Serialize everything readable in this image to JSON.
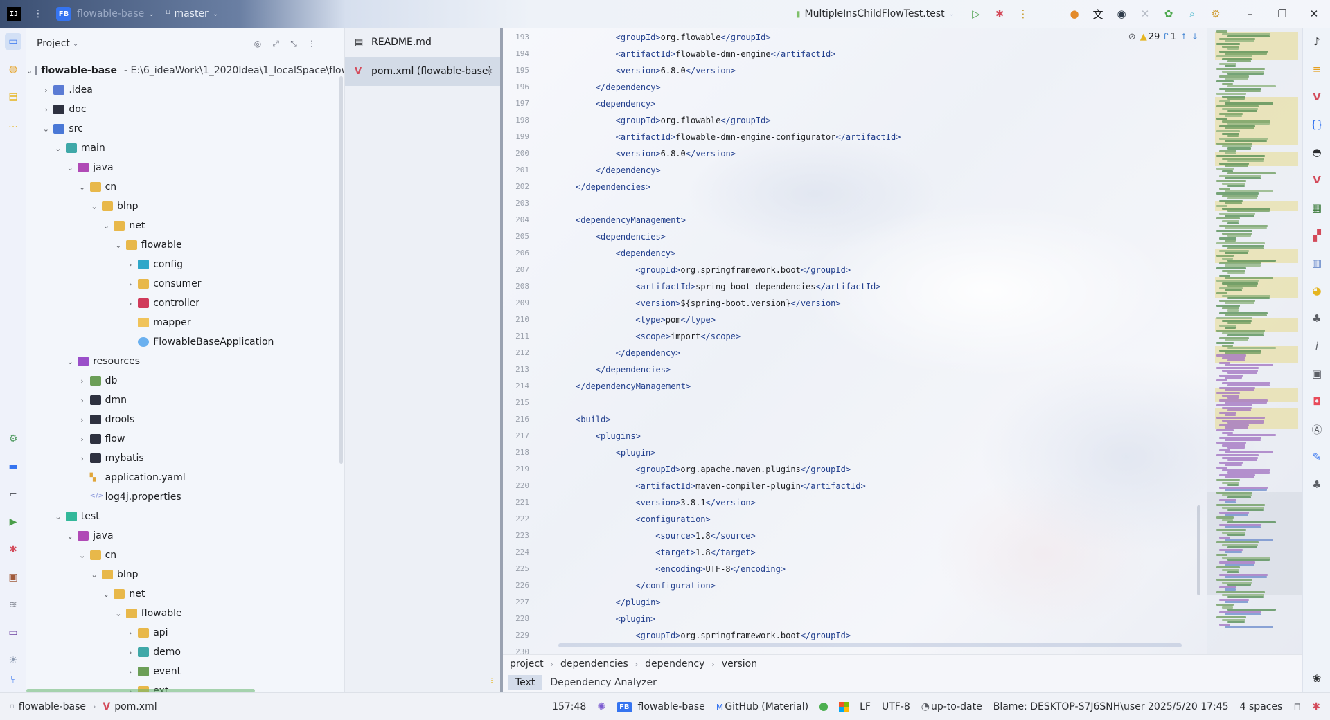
{
  "titlebar": {
    "app_logo": "IJ",
    "menu_glyph": "⋮",
    "project_badge": "FB",
    "project_name": "flowable-base",
    "branch": "master",
    "run_config": "MultipleInsChildFlowTest.test",
    "icons": [
      "run-icon",
      "debug-icon",
      "more-icon",
      "code-with-me-icon",
      "translate-icon",
      "record-icon",
      "tools-icon",
      "ai-assistant-icon",
      "search-icon",
      "settings-icon"
    ],
    "window_controls": [
      "minimize",
      "restore",
      "close"
    ]
  },
  "project_panel": {
    "title": "Project",
    "tree": [
      {
        "depth": 0,
        "arrow": "v",
        "icon": "module",
        "label": "flowable-base",
        "bold": true,
        "path": "E:\\6_ideaWork\\1_2020Idea\\1_localSpace\\flow"
      },
      {
        "depth": 1,
        "arrow": ">",
        "icon": "folder-blue",
        "label": ".idea"
      },
      {
        "depth": 1,
        "arrow": ">",
        "icon": "folder-dark",
        "label": "doc"
      },
      {
        "depth": 1,
        "arrow": "v",
        "icon": "folder-src",
        "label": "src"
      },
      {
        "depth": 2,
        "arrow": "v",
        "icon": "folder-main",
        "label": "main"
      },
      {
        "depth": 3,
        "arrow": "v",
        "icon": "folder-java",
        "label": "java"
      },
      {
        "depth": 4,
        "arrow": "v",
        "icon": "folder",
        "label": "cn"
      },
      {
        "depth": 5,
        "arrow": "v",
        "icon": "folder",
        "label": "blnp"
      },
      {
        "depth": 6,
        "arrow": "v",
        "icon": "folder",
        "label": "net"
      },
      {
        "depth": 7,
        "arrow": "v",
        "icon": "folder",
        "label": "flowable"
      },
      {
        "depth": 8,
        "arrow": ">",
        "icon": "folder-cfg",
        "label": "config"
      },
      {
        "depth": 8,
        "arrow": ">",
        "icon": "folder",
        "label": "consumer"
      },
      {
        "depth": 8,
        "arrow": ">",
        "icon": "folder-ctl",
        "label": "controller"
      },
      {
        "depth": 8,
        "arrow": "",
        "icon": "folder-plain",
        "label": "mapper"
      },
      {
        "depth": 8,
        "arrow": "",
        "icon": "spring",
        "label": "FlowableBaseApplication"
      },
      {
        "depth": 3,
        "arrow": "v",
        "icon": "folder-res",
        "label": "resources"
      },
      {
        "depth": 4,
        "arrow": ">",
        "icon": "folder-db",
        "label": "db"
      },
      {
        "depth": 4,
        "arrow": ">",
        "icon": "folder-dark",
        "label": "dmn"
      },
      {
        "depth": 4,
        "arrow": ">",
        "icon": "folder-dark",
        "label": "drools"
      },
      {
        "depth": 4,
        "arrow": ">",
        "icon": "folder-dark",
        "label": "flow"
      },
      {
        "depth": 4,
        "arrow": ">",
        "icon": "folder-dark",
        "label": "mybatis"
      },
      {
        "depth": 4,
        "arrow": "",
        "icon": "yaml",
        "label": "application.yaml"
      },
      {
        "depth": 4,
        "arrow": "",
        "icon": "props",
        "label": "log4j.properties"
      },
      {
        "depth": 2,
        "arrow": "v",
        "icon": "folder-test",
        "label": "test"
      },
      {
        "depth": 3,
        "arrow": "v",
        "icon": "folder-java",
        "label": "java"
      },
      {
        "depth": 4,
        "arrow": "v",
        "icon": "folder",
        "label": "cn"
      },
      {
        "depth": 5,
        "arrow": "v",
        "icon": "folder",
        "label": "blnp"
      },
      {
        "depth": 6,
        "arrow": "v",
        "icon": "folder",
        "label": "net"
      },
      {
        "depth": 7,
        "arrow": "v",
        "icon": "folder",
        "label": "flowable"
      },
      {
        "depth": 8,
        "arrow": ">",
        "icon": "folder",
        "label": "api"
      },
      {
        "depth": 8,
        "arrow": ">",
        "icon": "folder-main",
        "label": "demo"
      },
      {
        "depth": 8,
        "arrow": ">",
        "icon": "folder-db",
        "label": "event"
      },
      {
        "depth": 8,
        "arrow": ">",
        "icon": "folder",
        "label": "ext"
      }
    ]
  },
  "tabs": [
    {
      "label": "README.md",
      "icon": "markdown-icon",
      "active": false
    },
    {
      "label": "pom.xml (flowable-base)",
      "icon": "maven-icon",
      "active": true
    }
  ],
  "editor": {
    "inspections": {
      "warnings": "29",
      "typos": "1"
    },
    "lines": [
      {
        "n": "193",
        "indent": 2,
        "tokens": [
          [
            "t",
            "<groupId>"
          ],
          [
            "b",
            "org.flowable"
          ],
          [
            "t",
            "</groupId>"
          ]
        ]
      },
      {
        "n": "194",
        "indent": 2,
        "tokens": [
          [
            "t",
            "<artifactId>"
          ],
          [
            "b",
            "flowable-dmn-engine"
          ],
          [
            "t",
            "</artifactId>"
          ]
        ]
      },
      {
        "n": "195",
        "indent": 2,
        "tokens": [
          [
            "t",
            "<version>"
          ],
          [
            "b",
            "6.8.0"
          ],
          [
            "t",
            "</version>"
          ]
        ]
      },
      {
        "n": "196",
        "indent": 1,
        "tokens": [
          [
            "t",
            "</dependency>"
          ]
        ]
      },
      {
        "n": "197",
        "indent": 1,
        "tokens": [
          [
            "t",
            "<dependency>"
          ]
        ]
      },
      {
        "n": "198",
        "indent": 2,
        "tokens": [
          [
            "t",
            "<groupId>"
          ],
          [
            "b",
            "org.flowable"
          ],
          [
            "t",
            "</groupId>"
          ]
        ]
      },
      {
        "n": "199",
        "indent": 2,
        "tokens": [
          [
            "t",
            "<artifactId>"
          ],
          [
            "b",
            "flowable-dmn-engine-configurator"
          ],
          [
            "t",
            "</artifactId>"
          ]
        ]
      },
      {
        "n": "200",
        "indent": 2,
        "tokens": [
          [
            "t",
            "<version>"
          ],
          [
            "b",
            "6.8.0"
          ],
          [
            "t",
            "</version>"
          ]
        ]
      },
      {
        "n": "201",
        "indent": 1,
        "tokens": [
          [
            "t",
            "</dependency>"
          ]
        ]
      },
      {
        "n": "202",
        "indent": 0,
        "tokens": [
          [
            "t",
            "</dependencies>"
          ]
        ]
      },
      {
        "n": "203",
        "indent": 0,
        "tokens": []
      },
      {
        "n": "204",
        "indent": 0,
        "tokens": [
          [
            "t",
            "<dependencyManagement>"
          ]
        ]
      },
      {
        "n": "205",
        "indent": 1,
        "tokens": [
          [
            "t",
            "<dependencies>"
          ]
        ]
      },
      {
        "n": "206",
        "indent": 2,
        "tokens": [
          [
            "t",
            "<dependency>"
          ]
        ]
      },
      {
        "n": "207",
        "indent": 3,
        "tokens": [
          [
            "t",
            "<groupId>"
          ],
          [
            "b",
            "org.springframework.boot"
          ],
          [
            "t",
            "</groupId>"
          ]
        ]
      },
      {
        "n": "208",
        "indent": 3,
        "tokens": [
          [
            "t",
            "<artifactId>"
          ],
          [
            "b",
            "spring-boot-dependencies"
          ],
          [
            "t",
            "</artifactId>"
          ]
        ]
      },
      {
        "n": "209",
        "indent": 3,
        "tokens": [
          [
            "t",
            "<version>"
          ],
          [
            "b",
            "${spring-boot.version}"
          ],
          [
            "t",
            "</version>"
          ]
        ]
      },
      {
        "n": "210",
        "indent": 3,
        "tokens": [
          [
            "t",
            "<type>"
          ],
          [
            "b",
            "pom"
          ],
          [
            "t",
            "</type>"
          ]
        ]
      },
      {
        "n": "211",
        "indent": 3,
        "tokens": [
          [
            "t",
            "<scope>"
          ],
          [
            "b",
            "import"
          ],
          [
            "t",
            "</scope>"
          ]
        ]
      },
      {
        "n": "212",
        "indent": 2,
        "tokens": [
          [
            "t",
            "</dependency>"
          ]
        ]
      },
      {
        "n": "213",
        "indent": 1,
        "tokens": [
          [
            "t",
            "</dependencies>"
          ]
        ]
      },
      {
        "n": "214",
        "indent": 0,
        "tokens": [
          [
            "t",
            "</dependencyManagement>"
          ]
        ]
      },
      {
        "n": "215",
        "indent": 0,
        "tokens": []
      },
      {
        "n": "216",
        "indent": 0,
        "tokens": [
          [
            "t",
            "<build>"
          ]
        ]
      },
      {
        "n": "217",
        "indent": 1,
        "tokens": [
          [
            "t",
            "<plugins>"
          ]
        ]
      },
      {
        "n": "218",
        "indent": 2,
        "tokens": [
          [
            "t",
            "<plugin>"
          ]
        ]
      },
      {
        "n": "219",
        "indent": 3,
        "tokens": [
          [
            "t",
            "<groupId>"
          ],
          [
            "b",
            "org.apache.maven.plugins"
          ],
          [
            "t",
            "</groupId>"
          ]
        ]
      },
      {
        "n": "220",
        "indent": 3,
        "tokens": [
          [
            "t",
            "<artifactId>"
          ],
          [
            "b",
            "maven-compiler-plugin"
          ],
          [
            "t",
            "</artifactId>"
          ]
        ]
      },
      {
        "n": "221",
        "indent": 3,
        "tokens": [
          [
            "t",
            "<version>"
          ],
          [
            "b",
            "3.8.1"
          ],
          [
            "t",
            "</version>"
          ]
        ]
      },
      {
        "n": "222",
        "indent": 3,
        "tokens": [
          [
            "t",
            "<configuration>"
          ]
        ]
      },
      {
        "n": "223",
        "indent": 4,
        "tokens": [
          [
            "t",
            "<source>"
          ],
          [
            "b",
            "1.8"
          ],
          [
            "t",
            "</source>"
          ]
        ]
      },
      {
        "n": "224",
        "indent": 4,
        "tokens": [
          [
            "t",
            "<target>"
          ],
          [
            "b",
            "1.8"
          ],
          [
            "t",
            "</target>"
          ]
        ]
      },
      {
        "n": "225",
        "indent": 4,
        "tokens": [
          [
            "t",
            "<encoding>"
          ],
          [
            "b",
            "UTF-8"
          ],
          [
            "t",
            "</encoding>"
          ]
        ]
      },
      {
        "n": "226",
        "indent": 3,
        "tokens": [
          [
            "t",
            "</configuration>"
          ]
        ]
      },
      {
        "n": "227",
        "indent": 2,
        "tokens": [
          [
            "t",
            "</plugin>"
          ]
        ]
      },
      {
        "n": "228",
        "indent": 2,
        "tokens": [
          [
            "t",
            "<plugin>"
          ]
        ]
      },
      {
        "n": "229",
        "indent": 3,
        "tokens": [
          [
            "t",
            "<groupId>"
          ],
          [
            "b",
            "org.springframework.boot"
          ],
          [
            "t",
            "</groupId>"
          ]
        ]
      },
      {
        "n": "230",
        "indent": 0,
        "tokens": []
      }
    ]
  },
  "breadcrumb": [
    "project",
    "dependencies",
    "dependency",
    "version"
  ],
  "mode_tabs": [
    {
      "label": "Text",
      "active": true
    },
    {
      "label": "Dependency Analyzer",
      "active": false
    }
  ],
  "statusbar": {
    "path": [
      "flowable-base",
      "pom.xml"
    ],
    "position": "157:48",
    "project_badge": "FB",
    "project": "flowable-base",
    "theme": "GitHub (Material)",
    "line_sep": "LF",
    "encoding": "UTF-8",
    "vcs": "up-to-date",
    "blame": "Blame: DESKTOP-S7J6SNH\\user 2025/5/20 17:45",
    "indent": "4 spaces"
  }
}
